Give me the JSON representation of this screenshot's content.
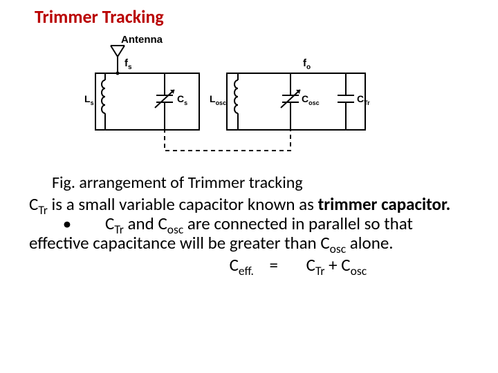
{
  "title": "Trimmer Tracking",
  "diagram": {
    "antenna": "Antenna",
    "fs": "f",
    "fs_sub": "s",
    "fo": "f",
    "fo_sub": "o",
    "Ls": "L",
    "Ls_sub": "s",
    "Cs": "C",
    "Cs_sub": "s",
    "Losc": "L",
    "Losc_sub": "osc",
    "Cosc": "C",
    "Cosc_sub": "osc",
    "CTr": "C",
    "CTr_sub": "Tr"
  },
  "caption": "Fig. arrangement of Trimmer tracking",
  "body": {
    "s1a": "C",
    "s1a_sub": "Tr",
    "s1b": " is a small variable capacitor known as ",
    "s1c": "trimmer capacitor.",
    "bullet": "•",
    "s2a": "C",
    "s2a_sub": "Tr",
    "s2b": " and C",
    "s2b_sub": "osc",
    "s2c": " are connected in parallel so that effective capacitance will be greater than C",
    "s2c_sub": "osc",
    "s2d": " alone."
  },
  "eq": {
    "lhs": "C",
    "lhs_sub": "eff.",
    "eq": "=",
    "r1": "C",
    "r1_sub": "Tr",
    "plus": " + ",
    "r2": "C",
    "r2_sub": "osc"
  }
}
